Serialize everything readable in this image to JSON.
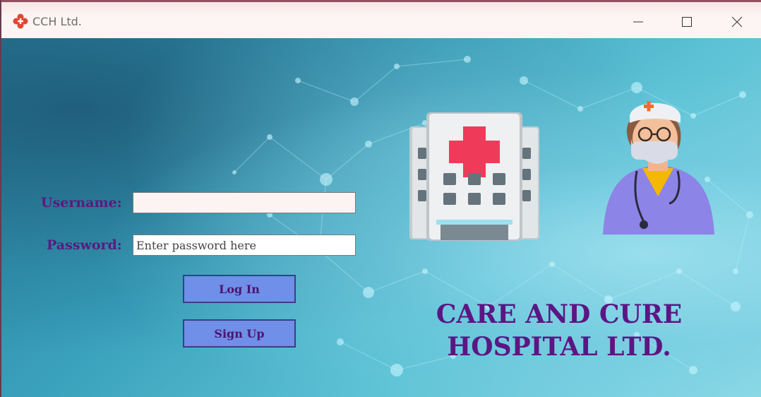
{
  "window": {
    "title": "CCH Ltd.",
    "controls": {
      "minimize": "minimize",
      "maximize": "maximize",
      "close": "close"
    }
  },
  "form": {
    "username_label": "Username:",
    "username_value": "",
    "password_label": "Password:",
    "password_placeholder": "Enter password here",
    "login_label": "Log In",
    "signup_label": "Sign Up"
  },
  "brand": {
    "line1": "CARE AND CURE",
    "line2": "HOSPITAL LTD."
  },
  "icons": {
    "app": "hospital-cross-icon",
    "hospital": "hospital-building-icon",
    "nurse": "nurse-illustration"
  },
  "colors": {
    "label_text": "#5a1a7e",
    "brand_text": "#5c1683",
    "button_fill": "#6f8fe8",
    "background_teal": "#3aa1bc",
    "cross_red": "#f03a5a"
  }
}
